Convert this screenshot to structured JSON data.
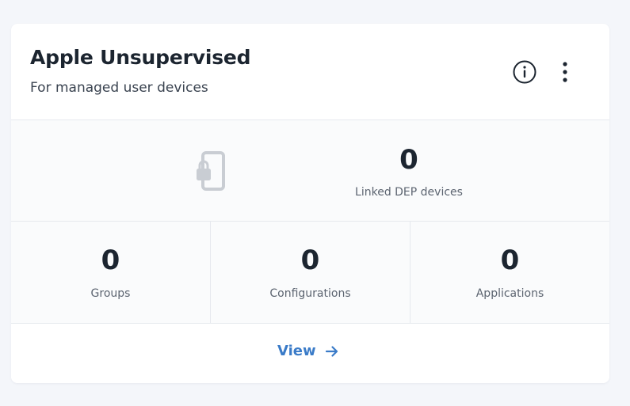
{
  "card": {
    "title": "Apple Unsupervised",
    "subtitle": "For managed user devices",
    "info_icon": "info-circle-icon",
    "menu_icon": "more-vertical-icon"
  },
  "linked": {
    "icon": "locked-phone-icon",
    "value": "0",
    "label": "Linked DEP devices"
  },
  "stats": [
    {
      "value": "0",
      "label": "Groups"
    },
    {
      "value": "0",
      "label": "Configurations"
    },
    {
      "value": "0",
      "label": "Applications"
    }
  ],
  "footer": {
    "view_label": "View",
    "arrow_icon": "arrow-right-icon"
  },
  "colors": {
    "accent": "#3a7bc8",
    "text_primary": "#1c2530",
    "text_secondary": "#5c6470",
    "icon_muted": "#c9cdd3",
    "divider": "#e6e9ee",
    "page_background": "#f4f6fa"
  }
}
